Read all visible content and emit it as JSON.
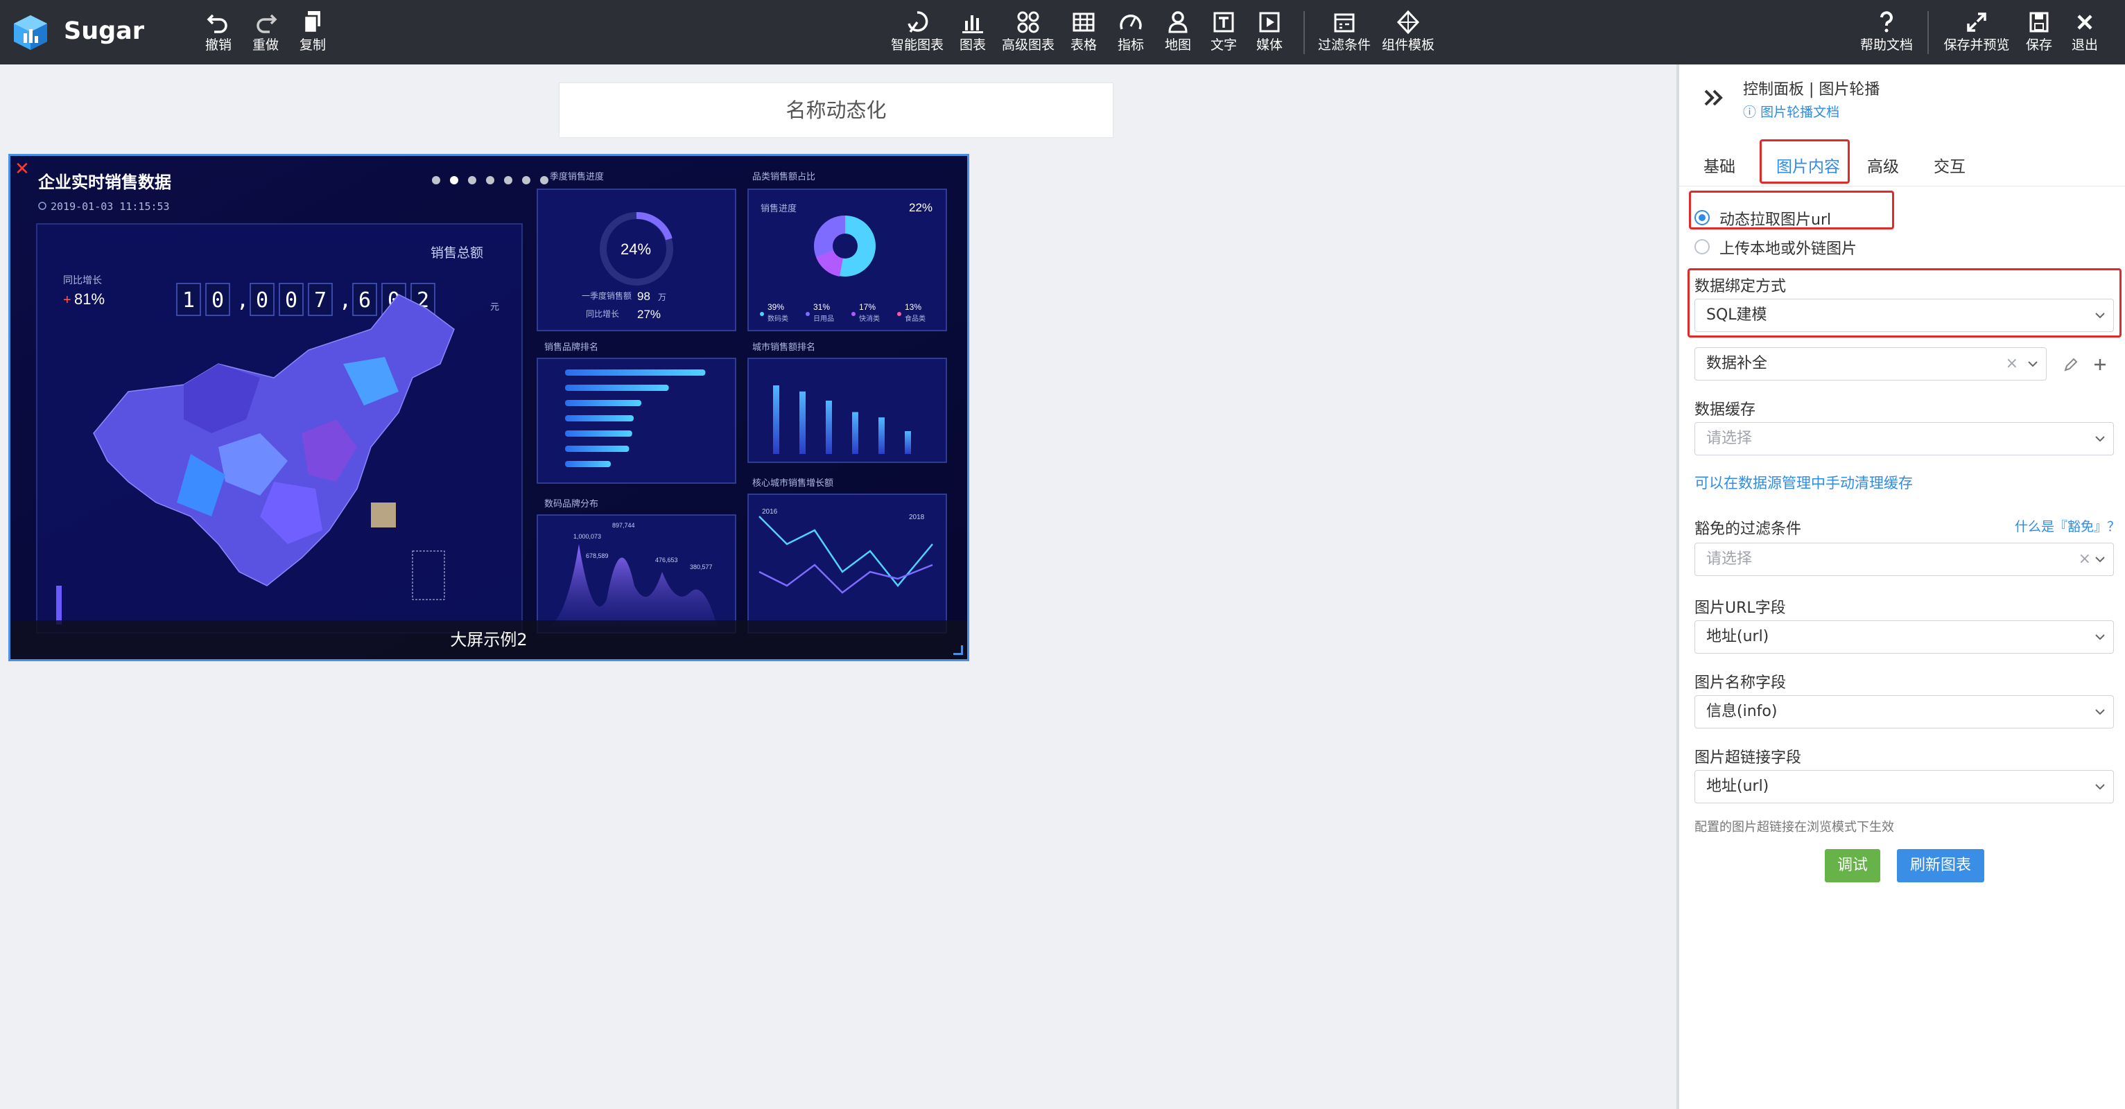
{
  "app": {
    "name": "Sugar"
  },
  "toolbar": {
    "left": [
      {
        "label": "撤销",
        "icon": "undo-icon"
      },
      {
        "label": "重做",
        "icon": "redo-icon"
      },
      {
        "label": "复制",
        "icon": "copy-icon"
      }
    ],
    "center": [
      {
        "label": "智能图表",
        "icon": "smart-chart-icon"
      },
      {
        "label": "图表",
        "icon": "bar-chart-icon"
      },
      {
        "label": "高级图表",
        "icon": "advanced-chart-icon"
      },
      {
        "label": "表格",
        "icon": "table-icon"
      },
      {
        "label": "指标",
        "icon": "gauge-icon"
      },
      {
        "label": "地图",
        "icon": "map-pin-icon"
      },
      {
        "label": "文字",
        "icon": "text-icon"
      },
      {
        "label": "媒体",
        "icon": "media-icon"
      },
      {
        "label": "过滤条件",
        "icon": "filter-icon"
      },
      {
        "label": "组件模板",
        "icon": "template-icon"
      }
    ],
    "right": [
      {
        "label": "帮助文档",
        "icon": "help-icon"
      },
      {
        "label": "保存并预览",
        "icon": "expand-icon"
      },
      {
        "label": "保存",
        "icon": "save-icon"
      },
      {
        "label": "退出",
        "icon": "close-icon"
      }
    ]
  },
  "canvas": {
    "title": "名称动态化",
    "carousel": {
      "caption": "大屏示例2",
      "slides_count": 7,
      "active_index": 1,
      "image": {
        "title": "企业实时销售数据",
        "datetime": "2019-01-03 11:15:53",
        "total_label": "销售总额",
        "total_digits": [
          "1",
          "0",
          ",",
          "0",
          "0",
          "7",
          ",",
          "6",
          "0",
          "2"
        ],
        "total_unit": "元",
        "yoy_label": "同比增长",
        "yoy_value": "81%",
        "q_title": "季度销售进度",
        "q_percent": "24%",
        "q_sales_label": "一季度销售额",
        "q_sales_value": "98",
        "q_sales_unit": "万",
        "q_yoy_label": "同比增长",
        "q_yoy_value": "27%",
        "cat_title": "品类销售额占比",
        "cat_sub": "销售进度",
        "cat_percent": "22%",
        "cat_items": [
          {
            "pct": "39%",
            "name": "数码类"
          },
          {
            "pct": "31%",
            "name": "日用品"
          },
          {
            "pct": "17%",
            "name": "快消类"
          },
          {
            "pct": "13%",
            "name": "食品类"
          }
        ],
        "brand_title": "销售品牌排名",
        "city_title": "城市销售额排名",
        "dist_title": "数码品牌分布",
        "growth_title": "核心城市销售增长额",
        "dist_values": [
          "1,000,073",
          "897,744",
          "678,589",
          "476,653",
          "380,577"
        ],
        "growth_values": [
          "2018",
          "2016"
        ]
      }
    }
  },
  "panel": {
    "title": "控制面板 | 图片轮播",
    "doc_link": "图片轮播文档",
    "tabs": [
      "基础",
      "图片内容",
      "高级",
      "交互"
    ],
    "active_tab": 1,
    "source_options": [
      "动态拉取图片url",
      "上传本地或外链图片"
    ],
    "binding_label": "数据绑定方式",
    "binding_value": "SQL建模",
    "model_value": "数据补全",
    "cache_label": "数据缓存",
    "cache_placeholder": "请选择",
    "cache_link": "可以在数据源管理中手动清理缓存",
    "exempt_label": "豁免的过滤条件",
    "exempt_help": "什么是『豁免』？",
    "exempt_placeholder": "请选择",
    "url_field_label": "图片URL字段",
    "url_field_value": "地址(url)",
    "name_field_label": "图片名称字段",
    "name_field_value": "信息(info)",
    "link_field_label": "图片超链接字段",
    "link_field_value": "地址(url)",
    "note": "配置的图片超链接在浏览模式下生效",
    "debug_button": "调试",
    "refresh_button": "刷新图表",
    "colors": {
      "accent": "#2f8bea",
      "debug": "#67b34a",
      "highlight": "#e02b2b"
    }
  }
}
